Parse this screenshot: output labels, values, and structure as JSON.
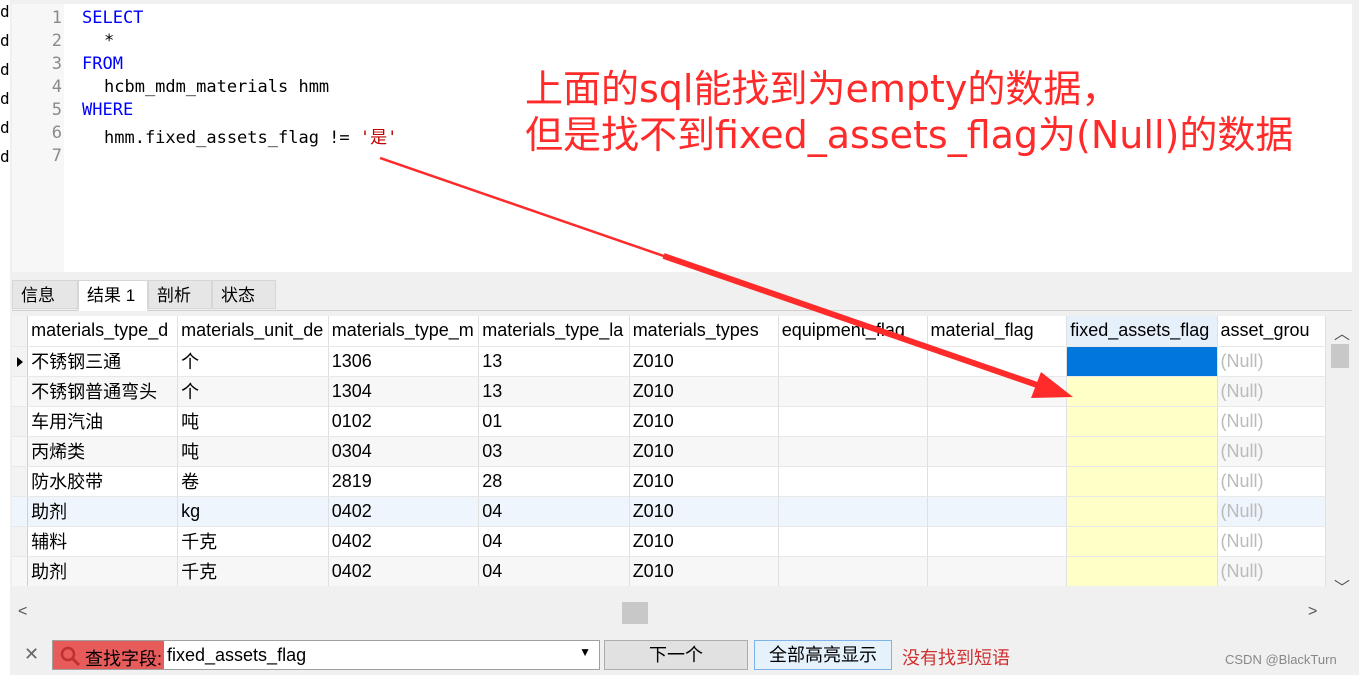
{
  "left_strip": [
    "d",
    "d",
    "d",
    "d",
    "d",
    "d"
  ],
  "editor": {
    "line_numbers": [
      "1",
      "2",
      "3",
      "4",
      "5",
      "6",
      "7"
    ],
    "lines": {
      "l1": "SELECT",
      "l2": "*",
      "l3": "FROM",
      "l4": "hcbm_mdm_materials hmm",
      "l5": "WHERE",
      "l6_code": "hmm.fixed_assets_flag != ",
      "l6_str": "'是'"
    }
  },
  "annotation": {
    "line1": "上面的sql能找到为empty的数据，",
    "line2": "但是找不到fixed_assets_flag为(Null)的数据",
    "color": "#ff2a2a"
  },
  "tabs": [
    "信息",
    "结果 1",
    "剖析",
    "状态"
  ],
  "active_tab": "结果 1",
  "grid": {
    "columns": [
      "materials_type_d",
      "materials_unit_de",
      "materials_type_m",
      "materials_type_la",
      "materials_types",
      "equipment_flag",
      "material_flag",
      "fixed_assets_flag",
      "asset_grou"
    ],
    "rows": [
      [
        "不锈钢三通",
        "个",
        "1306",
        "13",
        "Z010",
        "",
        "",
        "",
        "(Null)"
      ],
      [
        "不锈钢普通弯头",
        "个",
        "1304",
        "13",
        "Z010",
        "",
        "",
        "",
        "(Null)"
      ],
      [
        "车用汽油",
        "吨",
        "0102",
        "01",
        "Z010",
        "",
        "",
        "",
        "(Null)"
      ],
      [
        "丙烯类",
        "吨",
        "0304",
        "03",
        "Z010",
        "",
        "",
        "",
        "(Null)"
      ],
      [
        "防水胶带",
        "卷",
        "2819",
        "28",
        "Z010",
        "",
        "",
        "",
        "(Null)"
      ],
      [
        "助剂",
        "kg",
        "0402",
        "04",
        "Z010",
        "",
        "",
        "",
        "(Null)"
      ],
      [
        "辅料",
        "千克",
        "0402",
        "04",
        "Z010",
        "",
        "",
        "",
        "(Null)"
      ],
      [
        "助剂",
        "千克",
        "0402",
        "04",
        "Z010",
        "",
        "",
        "",
        "(Null)"
      ]
    ],
    "highlight_color": "#ffffc8",
    "selected_color": "#0077dd"
  },
  "findbar": {
    "label": "查找字段:",
    "value": "fixed_assets_flag",
    "next_button": "下一个",
    "highlight_all_button": "全部高亮显示",
    "status": "没有找到短语"
  },
  "watermark": "CSDN @BlackTurn",
  "icons": {
    "close": "close-icon",
    "search": "search-icon",
    "dropdown": "chevron-down-icon",
    "row_pointer": "row-pointer-icon"
  }
}
